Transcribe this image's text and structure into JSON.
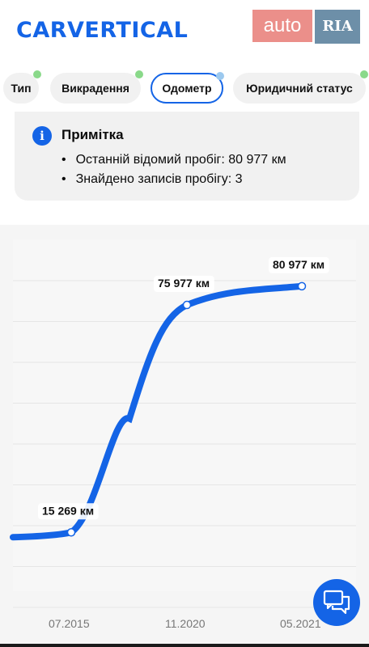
{
  "header": {
    "logo_text": "CARVERTICAL",
    "auto_badge": "auto",
    "ria_badge": "RIA"
  },
  "tabs": [
    {
      "label": "Тип",
      "dot_color": "#8ad98a",
      "active": false
    },
    {
      "label": "Викрадення",
      "dot_color": "#8ad98a",
      "active": false
    },
    {
      "label": "Одометр",
      "dot_color": "#9cc9ef",
      "active": true
    },
    {
      "label": "Юридичний статус",
      "dot_color": "#8ad98a",
      "active": false
    }
  ],
  "note": {
    "icon": "info-icon",
    "icon_glyph": "i",
    "title": "Примітка",
    "items": [
      "Останній відомий пробіг: 80 977 км",
      "Знайдено записів пробігу: 3"
    ]
  },
  "chart_data": {
    "type": "line",
    "x": [
      "07.2015",
      "11.2020",
      "05.2021"
    ],
    "values": [
      15269,
      75977,
      80977
    ],
    "point_labels": [
      "15 269 км",
      "75 977 км",
      "80 977 км"
    ],
    "x_tick_labels": [
      "07.2015",
      "11.2020",
      "05.2021"
    ],
    "title": "",
    "xlabel": "",
    "ylabel": "",
    "grid": true,
    "line_color": "#1464e6"
  },
  "chat_button": {
    "icon": "chat-icon"
  }
}
